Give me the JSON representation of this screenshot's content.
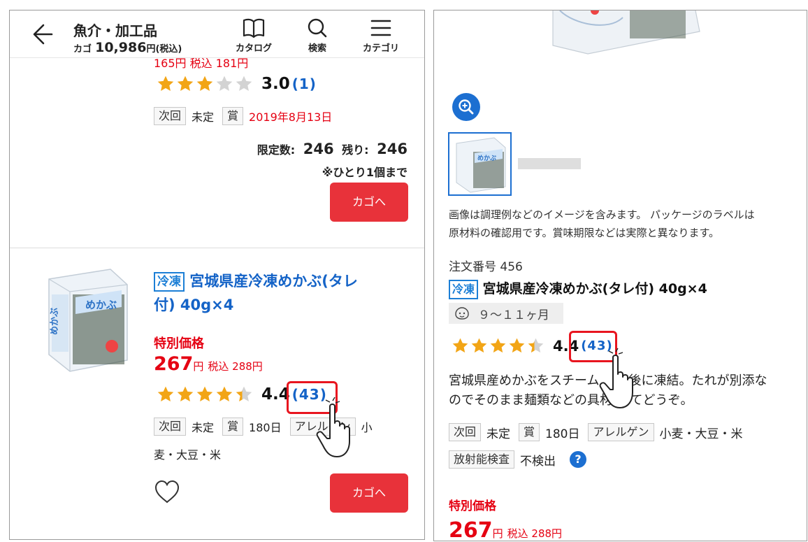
{
  "header": {
    "title": "魚介・加工品",
    "cart_label": "カゴ",
    "cart_amount": "10,986",
    "cart_unit": "円(税込)",
    "nav": [
      {
        "label": "カタログ",
        "icon": "book-icon"
      },
      {
        "label": "検索",
        "icon": "search-icon"
      },
      {
        "label": "カテゴリ",
        "icon": "menu-icon"
      }
    ]
  },
  "item1": {
    "price_cutoff": "165円 税込 181円",
    "stars": 3.0,
    "rating": "3.0",
    "rating_count": "(1)",
    "next_tag": "次回",
    "next_value": "未定",
    "prize_tag": "賞",
    "prize_value": "2019年8月13日",
    "limit_label": "限定数:",
    "limit_value": "246",
    "remain_label": "残り:",
    "remain_value": "246",
    "limit_note": "※ひとり1個まで",
    "cart_button": "カゴへ"
  },
  "item2": {
    "frozen": "冷凍",
    "name_line1": "宮城県産冷凍めかぶ(タレ",
    "name_line2": "付) 40g×4",
    "special_label": "特別価格",
    "price": "267",
    "price_unit": "円",
    "tax_price": "税込 288円",
    "stars": 4.4,
    "rating": "4.4",
    "rating_count": "(43)",
    "next_tag": "次回",
    "next_value": "未定",
    "prize_tag": "賞",
    "prize_value": "180日",
    "allergen_tag": "アレルゲン",
    "allergen_value_part": "小",
    "allergen_value_rest": "麦・大豆・米",
    "cart_button": "カゴへ"
  },
  "detail": {
    "image_note_line1": "画像は調理例などのイメージを含みます。 パッケージのラベルは",
    "image_note_line2": "原材料の確認用です。賞味期限などは実際と異なります。",
    "order_number": "注文番号 456",
    "frozen": "冷凍",
    "name": "宮城県産冷凍めかぶ(タレ付) 40g×4",
    "age": "９～１１ヶ月",
    "stars": 4.4,
    "rating": "4.4",
    "rating_count": "(43)",
    "desc_line1": "宮城県産めかぶをスチーム",
    "desc_line1_end": "後に凍結。たれが別添な",
    "desc_line2": "のでそのまま麺類などの具材",
    "desc_line2_end": "してどうぞ。",
    "next_tag": "次回",
    "next_value": "未定",
    "prize_tag": "賞",
    "prize_value": "180日",
    "allergen_tag": "アレルゲン",
    "allergen_value": "小麦・大豆・米",
    "radiation_tag": "放射能検査",
    "radiation_value": "不検出",
    "special_label": "特別価格",
    "price": "267",
    "price_unit": "円",
    "tax_price": "税込 288円"
  },
  "colors": {
    "accent_red": "#e8323a",
    "link_blue": "#1463c7",
    "star_gold": "#f2a516",
    "star_gray": "#d3d3d3",
    "highlight_red": "#e8151f"
  }
}
